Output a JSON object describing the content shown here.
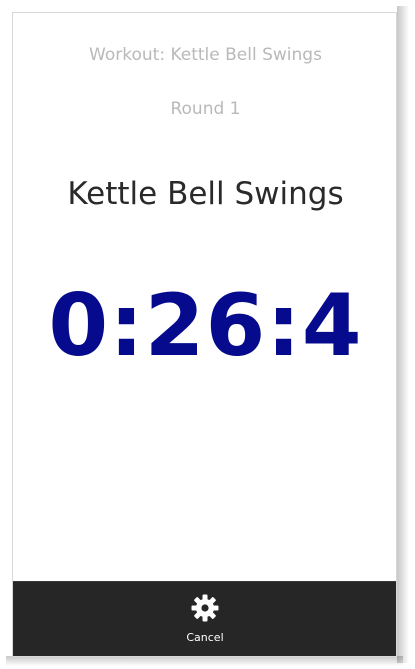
{
  "workout": {
    "title": "Workout: Kettle Bell Swings",
    "round": "Round 1",
    "exercise": "Kettle Bell Swings",
    "timer": "0:26:4"
  },
  "action_bar": {
    "cancel": {
      "label": "Cancel",
      "icon": "gear-icon"
    }
  },
  "colors": {
    "timer": "#060b8e",
    "muted_text": "#b9b9b9",
    "action_bar": "#262626"
  }
}
